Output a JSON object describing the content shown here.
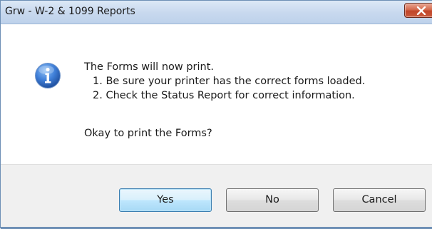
{
  "window": {
    "title": "Grw - W-2 & 1099 Reports"
  },
  "message": {
    "heading": "The Forms will now print.",
    "step1": "1. Be sure your printer has the correct forms loaded.",
    "step2": "2. Check the Status Report for correct information.",
    "question": "Okay to print the Forms?"
  },
  "buttons": {
    "yes": "Yes",
    "no": "No",
    "cancel": "Cancel"
  },
  "icons": {
    "dialog": "information-icon",
    "close": "close-icon"
  },
  "colors": {
    "close_button": "#c85a3c",
    "info_icon": "#2a66c4",
    "default_button_border": "#3c7fb1"
  }
}
